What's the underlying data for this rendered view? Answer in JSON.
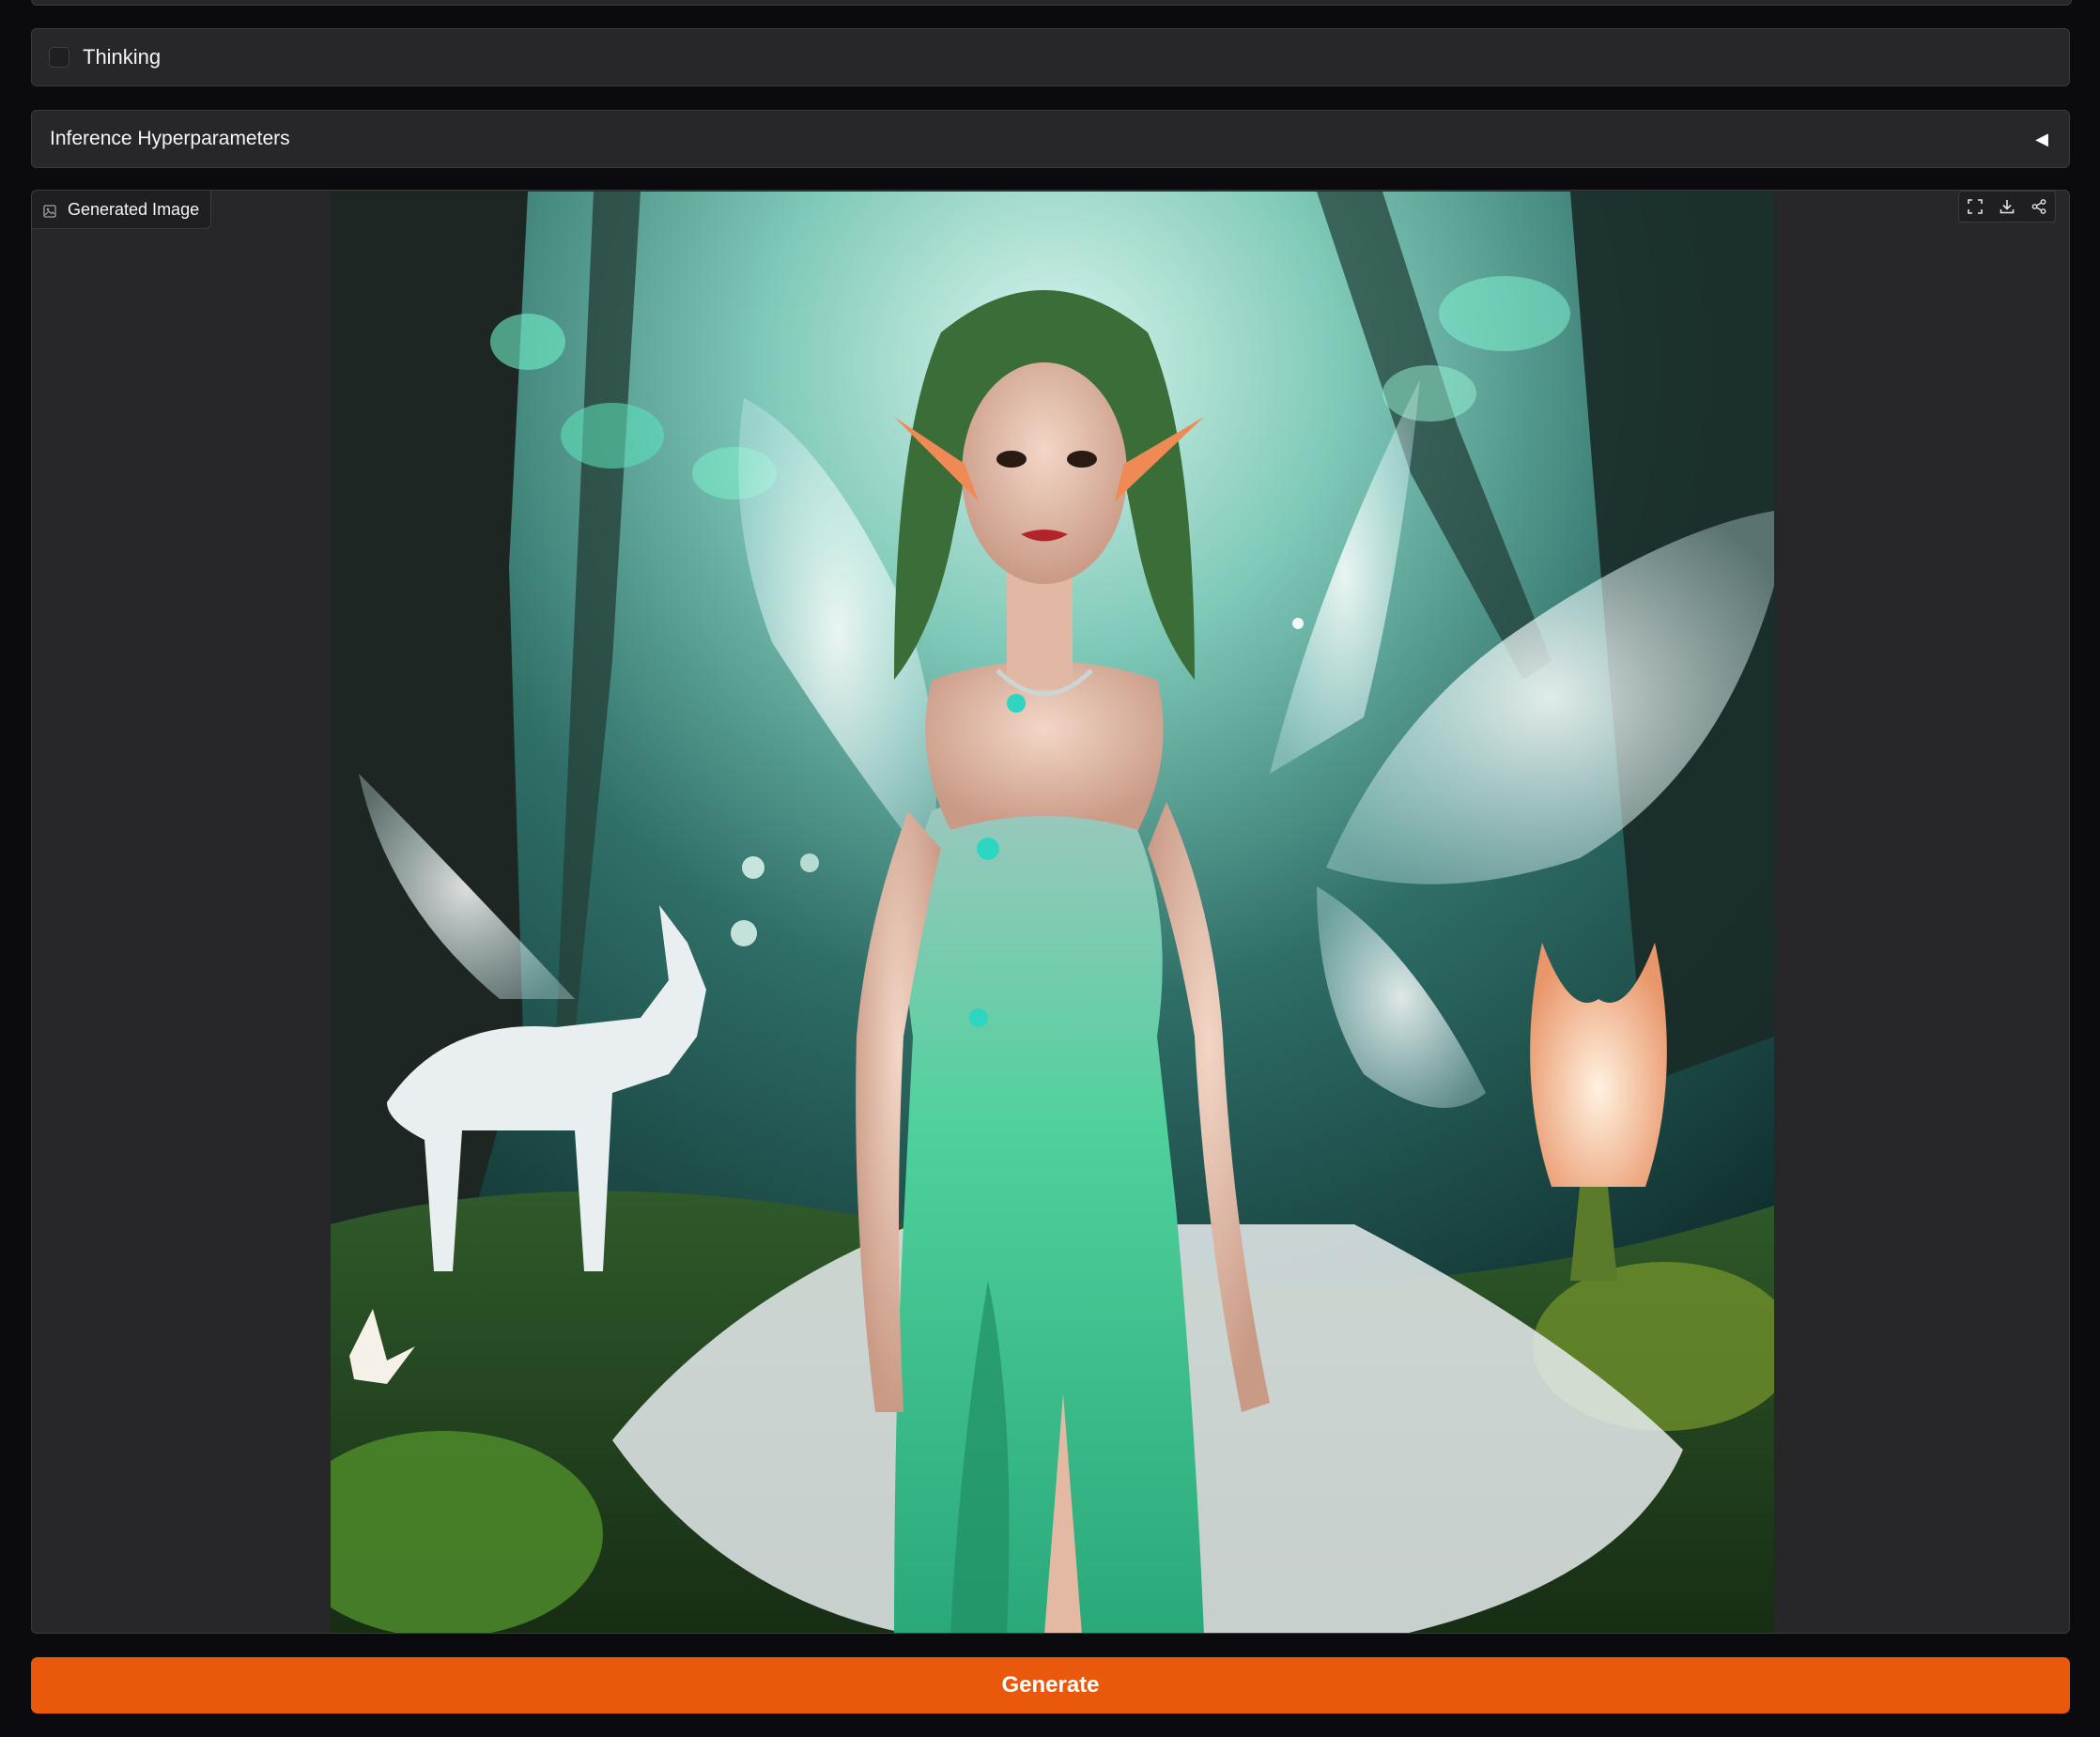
{
  "thinking": {
    "label": "Thinking",
    "checked": false
  },
  "accordion": {
    "title": "Inference Hyperparameters",
    "arrow": "◀",
    "expanded": false
  },
  "image_output": {
    "label": "Generated Image",
    "label_icon": "image-icon",
    "toolbar": [
      {
        "name": "fullscreen-icon"
      },
      {
        "name": "download-icon"
      },
      {
        "name": "share-icon"
      }
    ]
  },
  "generate": {
    "label": "Generate"
  },
  "colors": {
    "accent": "#ea580c",
    "panel": "#27272a",
    "background": "#0b0b0f"
  }
}
